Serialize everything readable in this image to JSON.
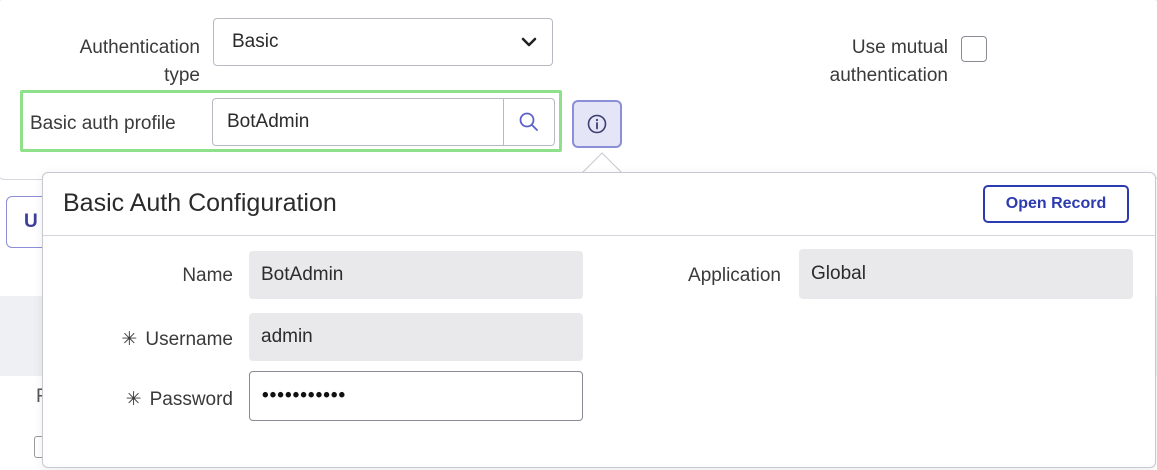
{
  "form": {
    "auth_type_label": "Authentication type",
    "auth_type_value": "Basic",
    "mutual_label": "Use mutual authentication",
    "mutual_checked": false,
    "profile_label": "Basic auth profile",
    "profile_value": "BotAdmin"
  },
  "background": {
    "partial_button_text": "U",
    "partial_row_text": "F"
  },
  "popover": {
    "title": "Basic Auth Configuration",
    "open_record_label": "Open Record",
    "fields": {
      "name_label": "Name",
      "name_value": "BotAdmin",
      "username_label": "Username",
      "username_value": "admin",
      "password_label": "Password",
      "password_value": "•••••••••••",
      "application_label": "Application",
      "application_value": "Global"
    },
    "required_marker": "✳"
  },
  "colors": {
    "highlight_border": "#8ee08a",
    "accent": "#2d3bb0",
    "info_button_bg": "#e4e5f7"
  },
  "icons": {
    "search": "search-icon",
    "info": "info-icon",
    "chevron": "chevron-down-icon"
  }
}
